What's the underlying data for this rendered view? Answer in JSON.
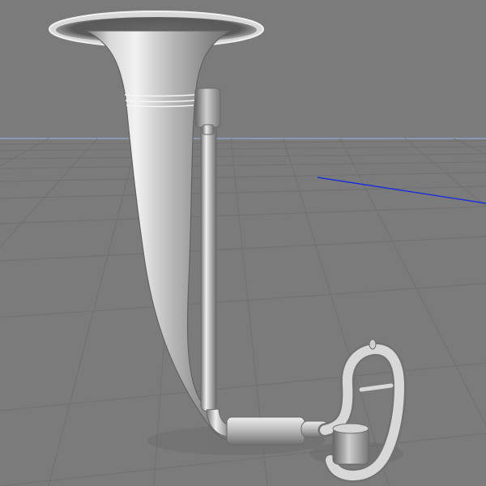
{
  "viewport": {
    "name": "3D perspective viewport",
    "background_color": "#7b7b7b",
    "grid_color": "#707070",
    "horizon_color": "#8ea3c6",
    "axis_color": "#1d2fd8"
  },
  "model": {
    "name": "horn",
    "material_color": "#b9b9b9",
    "shadow_color": "#6b6b6b"
  }
}
